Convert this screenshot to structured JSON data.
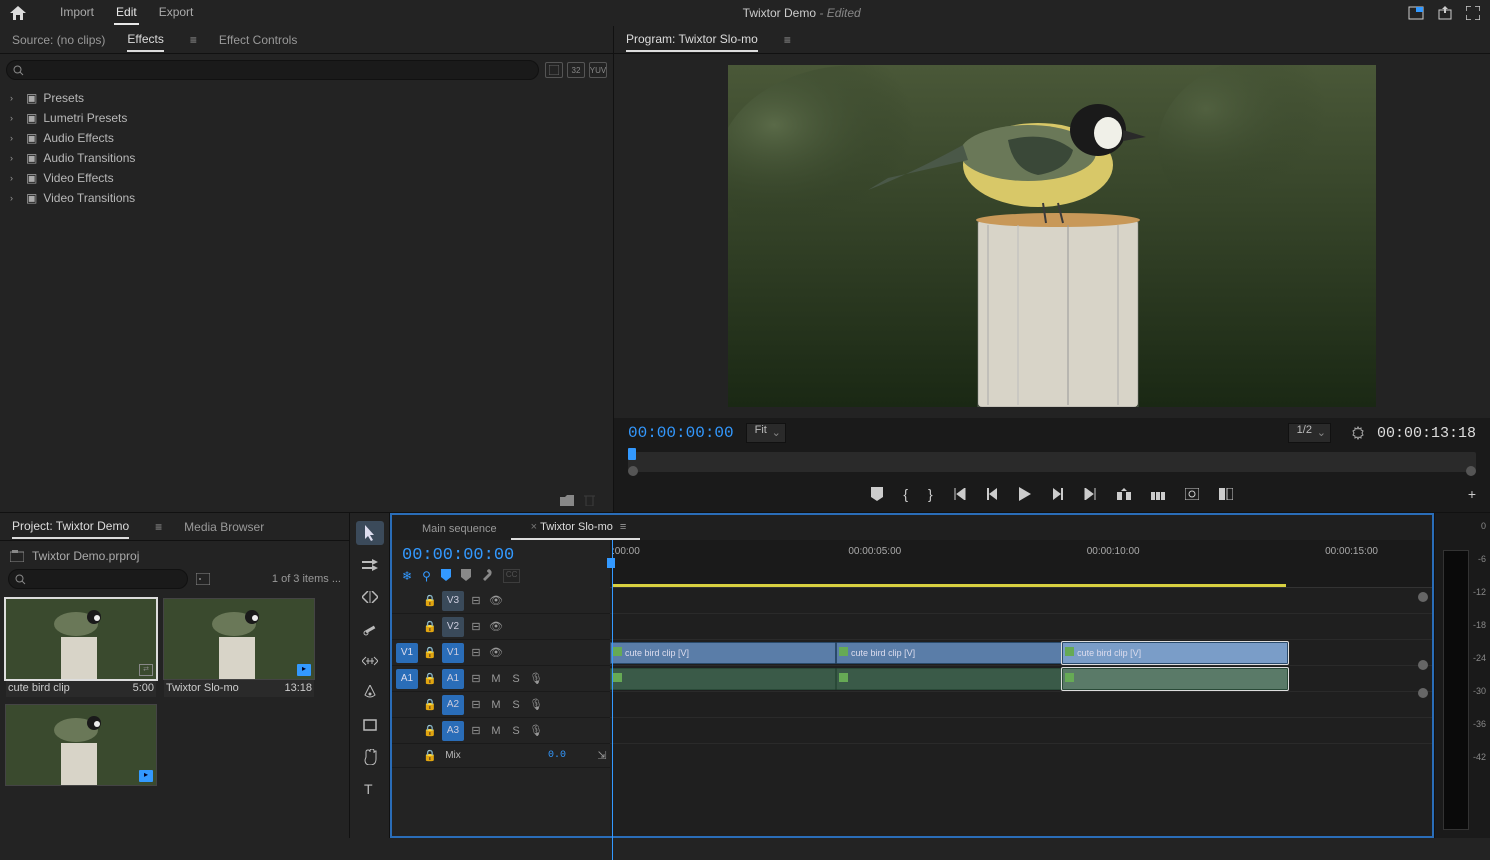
{
  "topbar": {
    "workspaces": [
      "Import",
      "Edit",
      "Export"
    ],
    "active_workspace": "Edit",
    "project_title": "Twixtor Demo",
    "edited_suffix": "- Edited"
  },
  "left_panel": {
    "tabs": [
      "Source: (no clips)",
      "Effects",
      "Effect Controls"
    ],
    "active_tab": "Effects",
    "tree": [
      "Presets",
      "Lumetri Presets",
      "Audio Effects",
      "Audio Transitions",
      "Video Effects",
      "Video Transitions"
    ]
  },
  "program": {
    "tab": "Program: Twixtor Slo-mo",
    "timecode_in": "00:00:00:00",
    "zoom": "Fit",
    "resolution": "1/2",
    "timecode_out": "00:00:13:18"
  },
  "project": {
    "tabs": [
      "Project: Twixtor Demo",
      "Media Browser"
    ],
    "active_tab": "Project: Twixtor Demo",
    "file_name": "Twixtor Demo.prproj",
    "item_count": "1 of 3 items ...",
    "bins": [
      {
        "name": "cute bird clip",
        "dur": "5:00",
        "type": "clip",
        "selected": true
      },
      {
        "name": "Twixtor Slo-mo",
        "dur": "13:18",
        "type": "sequence",
        "selected": false
      },
      {
        "name": "",
        "dur": "",
        "type": "sequence",
        "selected": false
      }
    ]
  },
  "timeline": {
    "tabs": [
      {
        "name": "Main sequence",
        "active": false
      },
      {
        "name": "Twixtor Slo-mo",
        "active": true
      }
    ],
    "timecode": "00:00:00:00",
    "ruler_ticks": [
      {
        "label": ":00:00",
        "pct": 0
      },
      {
        "label": "00:00:05:00",
        "pct": 29
      },
      {
        "label": "00:00:10:00",
        "pct": 58
      },
      {
        "label": "00:00:15:00",
        "pct": 87
      }
    ],
    "yellow_bar_pct": 82,
    "video_tracks": [
      {
        "src": "",
        "tgt": "V3",
        "tgt_on": false
      },
      {
        "src": "",
        "tgt": "V2",
        "tgt_on": false
      },
      {
        "src": "V1",
        "tgt": "V1",
        "tgt_on": true
      }
    ],
    "audio_tracks": [
      {
        "src": "A1",
        "tgt": "A1",
        "tgt_on": true
      },
      {
        "src": "",
        "tgt": "A2",
        "tgt_on": true
      },
      {
        "src": "",
        "tgt": "A3",
        "tgt_on": true
      }
    ],
    "mix_label": "Mix",
    "mix_value": "0.0",
    "clips_v1": [
      {
        "name": "cute bird clip [V]",
        "left_pct": 0,
        "width_pct": 27.5,
        "sel": false
      },
      {
        "name": "cute bird clip [V]",
        "left_pct": 27.5,
        "width_pct": 27.5,
        "sel": false
      },
      {
        "name": "cute bird clip [V]",
        "left_pct": 55,
        "width_pct": 27.5,
        "sel": true
      }
    ],
    "clips_a1": [
      {
        "left_pct": 0,
        "width_pct": 27.5,
        "sel": false
      },
      {
        "left_pct": 27.5,
        "width_pct": 27.5,
        "sel": false
      },
      {
        "left_pct": 55,
        "width_pct": 27.5,
        "sel": true
      }
    ]
  },
  "meters": {
    "scale": [
      "0",
      "-6",
      "-12",
      "-18",
      "-24",
      "-30",
      "-36",
      "-42"
    ]
  }
}
